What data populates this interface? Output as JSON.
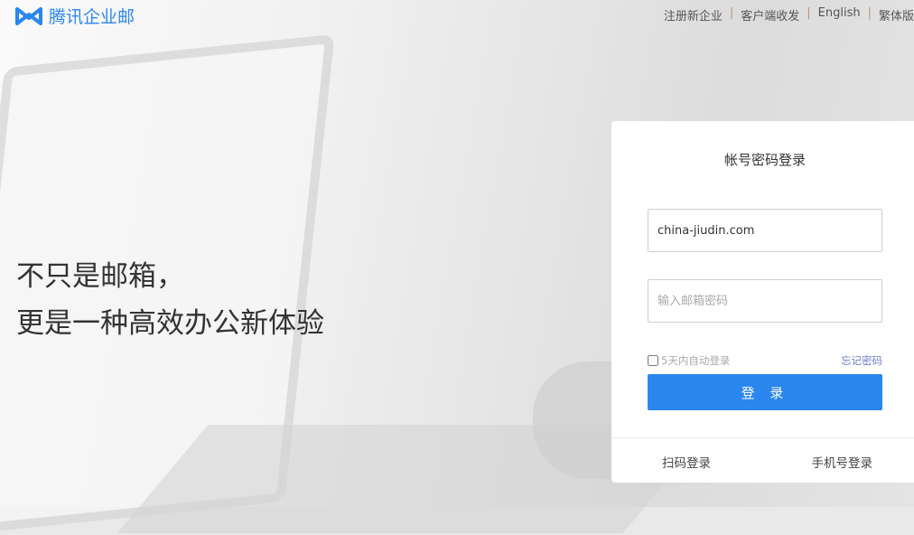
{
  "brand": {
    "name": "腾讯企业邮",
    "color": "#2b86f0"
  },
  "topnav": [
    "注册新企业",
    "客户端收发",
    "English",
    "繁体版"
  ],
  "slogan": {
    "line1": "不只是邮箱，",
    "line2": "更是一种高效办公新体验"
  },
  "login": {
    "title": "帐号密码登录",
    "account_value": "china-jiudin.com",
    "password_placeholder": "输入邮箱密码",
    "auto_login": "5天内自动登录",
    "auto_login_checked": false,
    "forgot": "忘记密码",
    "submit": "登 录",
    "alt_qr": "扫码登录",
    "alt_phone": "手机号登录",
    "accent": "#2b86ee"
  }
}
